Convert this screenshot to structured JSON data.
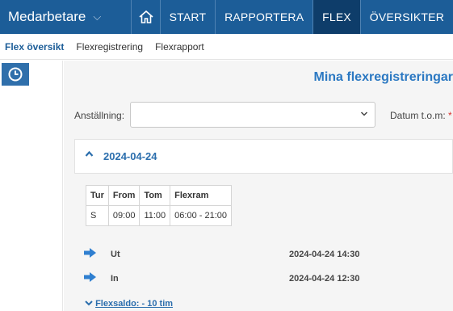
{
  "topnav": {
    "brand": "Medarbetare",
    "items": [
      {
        "label": "START"
      },
      {
        "label": "RAPPORTERA"
      },
      {
        "label": "FLEX"
      },
      {
        "label": "ÖVERSIKTER"
      }
    ],
    "active_item": "FLEX",
    "bar_color": "#1c5d98",
    "active_color": "#0e3d6a"
  },
  "subnav": {
    "items": [
      {
        "label": "Flex översikt"
      },
      {
        "label": "Flexregistrering"
      },
      {
        "label": "Flexrapport"
      }
    ],
    "active_item": "Flex översikt"
  },
  "sidebar": {
    "icon": "clock-icon"
  },
  "main": {
    "title": "Mina flexregistreringar",
    "employment_label": "Anställning:",
    "employment_value": "",
    "date_label": "Datum t.o.m:",
    "date_required_marker": "*",
    "section_date": "2024-04-24",
    "table": {
      "headers": [
        "Tur",
        "From",
        "Tom",
        "Flexram"
      ],
      "rows": [
        [
          "S",
          "09:00",
          "11:00",
          "06:00 - 21:00"
        ]
      ]
    },
    "events": [
      {
        "label": "Ut",
        "timestamp": "2024-04-24 14:30",
        "icon": "sign-out-icon"
      },
      {
        "label": "In",
        "timestamp": "2024-04-24 12:30",
        "icon": "sign-in-icon"
      }
    ],
    "flexsaldo": "Flexsaldo: - 10 tim"
  }
}
